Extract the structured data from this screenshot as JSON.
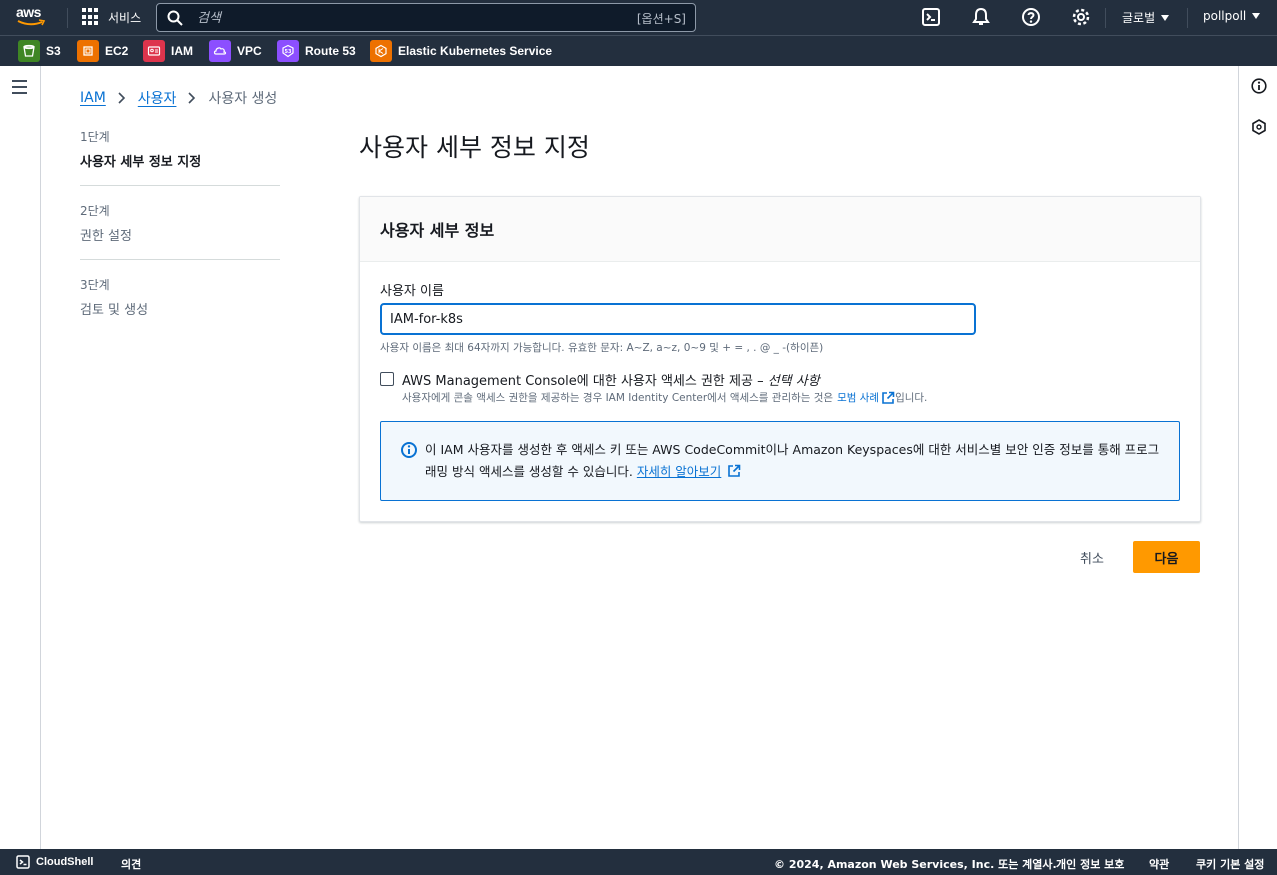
{
  "topnav": {
    "logo_text": "aws",
    "services_label": "서비스",
    "search_placeholder": "검색",
    "search_shortcut": "[옵션+S]",
    "region_label": "글로벌",
    "account_label": "pollpoll"
  },
  "favorites": [
    {
      "label": "S3",
      "color": "#3f8624"
    },
    {
      "label": "EC2",
      "color": "#ed7100"
    },
    {
      "label": "IAM",
      "color": "#dd344c"
    },
    {
      "label": "VPC",
      "color": "#8c4fff"
    },
    {
      "label": "Route 53",
      "color": "#8c4fff"
    },
    {
      "label": "Elastic Kubernetes Service",
      "color": "#ed7100"
    }
  ],
  "breadcrumb": {
    "items": [
      "IAM",
      "사용자"
    ],
    "current": "사용자 생성"
  },
  "steps": [
    {
      "num": "1단계",
      "title": "사용자 세부 정보 지정"
    },
    {
      "num": "2단계",
      "title": "권한 설정"
    },
    {
      "num": "3단계",
      "title": "검토 및 생성"
    }
  ],
  "main": {
    "title": "사용자 세부 정보 지정",
    "panel_title": "사용자 세부 정보",
    "username_label": "사용자 이름",
    "username_value": "IAM-for-k8s",
    "username_hint": "사용자 이름은 최대 64자까지 가능합니다. 유효한 문자: A~Z, a~z, 0~9 및 + = , . @ _ -(하이픈)",
    "console_access_label": "AWS Management Console에 대한 사용자 액세스 권한 제공 –",
    "console_access_optional": "선택 사항",
    "console_access_desc": "사용자에게 콘솔 액세스 권한을 제공하는 경우 IAM Identity Center에서 액세스를 관리하는 것은",
    "console_access_link": "모범 사례",
    "console_access_suffix": "입니다.",
    "info_text": "이 IAM 사용자를 생성한 후 액세스 키 또는 AWS CodeCommit이나 Amazon Keyspaces에 대한 서비스별 보안 인증 정보를 통해 프로그래밍 방식 액세스를 생성할 수 있습니다.",
    "info_link": "자세히 알아보기"
  },
  "actions": {
    "cancel": "취소",
    "next": "다음"
  },
  "footer": {
    "cloudshell": "CloudShell",
    "feedback": "의견",
    "copyright": "© 2024, Amazon Web Services, Inc. 또는 계열사.",
    "privacy": "개인 정보 보호",
    "terms": "약관",
    "cookie": "쿠키 기본 설정"
  },
  "colors": {
    "nav_bg": "#232f3e",
    "link": "#0972d3",
    "primary_button": "#ff9900",
    "info_bg": "#f2f8fd"
  }
}
